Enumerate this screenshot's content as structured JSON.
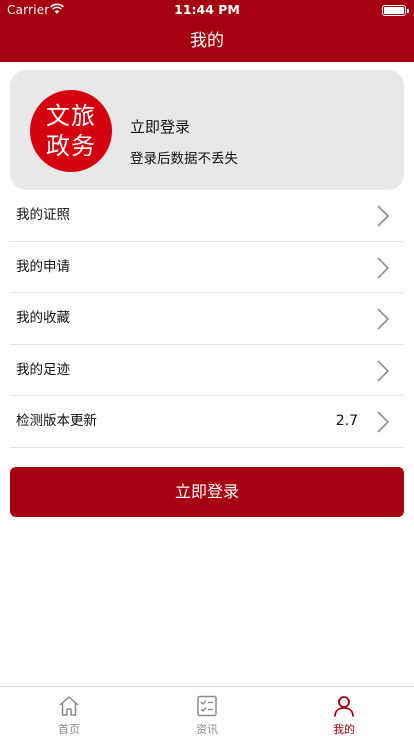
{
  "status_bar": {
    "carrier": "Carrier",
    "time": "11:44 PM"
  },
  "nav": {
    "title": "我的"
  },
  "profile": {
    "logo_line1": "文旅",
    "logo_line2": "政务",
    "title": "立即登录",
    "subtitle": "登录后数据不丢失"
  },
  "menu": {
    "items": [
      {
        "label": "我的证照",
        "value": ""
      },
      {
        "label": "我的申请",
        "value": ""
      },
      {
        "label": "我的收藏",
        "value": ""
      },
      {
        "label": "我的足迹",
        "value": ""
      },
      {
        "label": "检测版本更新",
        "value": "2.7"
      }
    ]
  },
  "login_button": {
    "label": "立即登录"
  },
  "tabbar": {
    "tabs": [
      {
        "label": "首页",
        "icon": "home-icon"
      },
      {
        "label": "资讯",
        "icon": "news-icon"
      },
      {
        "label": "我的",
        "icon": "profile-icon"
      }
    ],
    "active_index": 2
  },
  "colors": {
    "brand": "#a5000f",
    "logo": "#d3000f",
    "card_bg": "#e8e8e8",
    "inactive_tab": "#8a8a8a"
  }
}
